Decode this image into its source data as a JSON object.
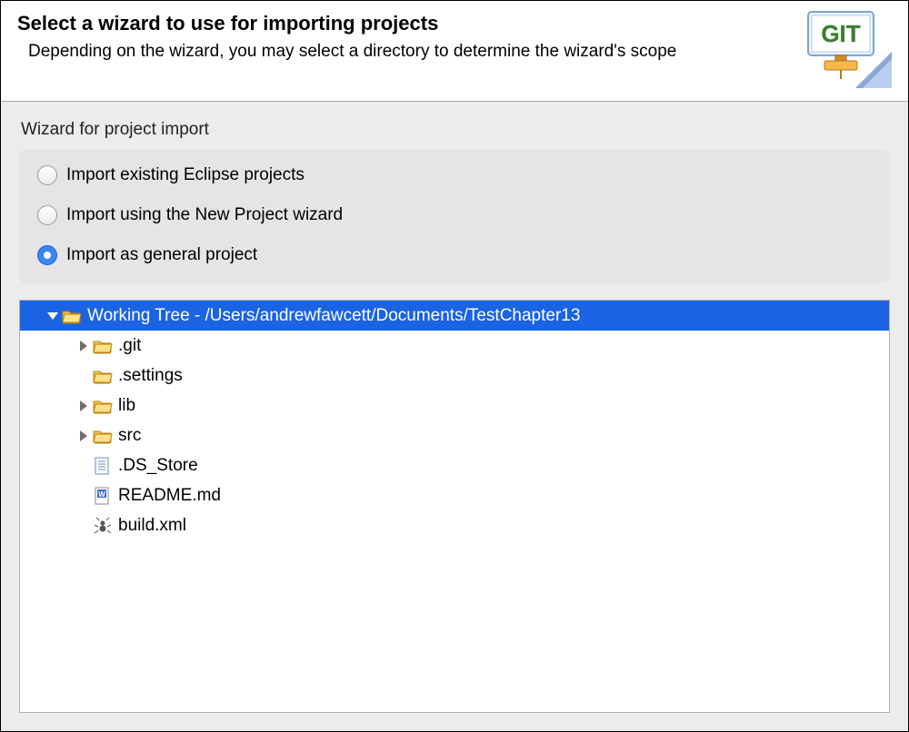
{
  "header": {
    "title": "Select a wizard to use for importing projects",
    "subtitle": "Depending on the wizard, you may select a directory to determine the wizard's scope",
    "brand": "GIT"
  },
  "radios": {
    "group_label": "Wizard for project import",
    "options": [
      {
        "id": "import-existing",
        "label": "Import existing Eclipse projects",
        "selected": false
      },
      {
        "id": "import-new-wizard",
        "label": "Import using the New Project wizard",
        "selected": false
      },
      {
        "id": "import-general",
        "label": "Import as general project",
        "selected": true
      }
    ]
  },
  "tree": {
    "root": {
      "label": "Working Tree - /Users/andrewfawcett/Documents/TestChapter13",
      "expanded": true,
      "selected": true,
      "icon": "folder-open",
      "children": [
        {
          "label": ".git",
          "icon": "folder-open",
          "expandable": true,
          "expanded": false
        },
        {
          "label": ".settings",
          "icon": "folder-open",
          "expandable": false
        },
        {
          "label": "lib",
          "icon": "folder-open",
          "expandable": true,
          "expanded": false
        },
        {
          "label": "src",
          "icon": "folder-open",
          "expandable": true,
          "expanded": false
        },
        {
          "label": ".DS_Store",
          "icon": "file-text"
        },
        {
          "label": "README.md",
          "icon": "file-word"
        },
        {
          "label": "build.xml",
          "icon": "file-ant"
        }
      ]
    }
  }
}
